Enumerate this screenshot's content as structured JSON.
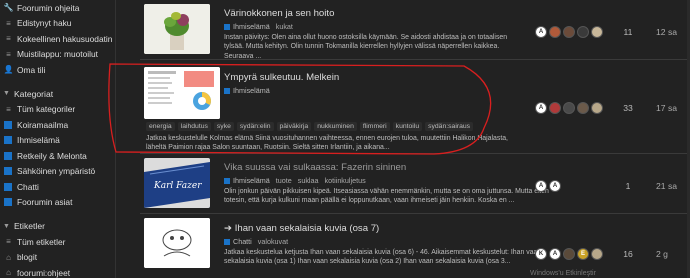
{
  "sidebar": {
    "top_items": [
      {
        "icon": "wrench-icon",
        "label": "Foorumin ohjeita"
      },
      {
        "icon": "list-icon",
        "label": "Edistynyt haku"
      },
      {
        "icon": "list-icon",
        "label": "Kokeellinen hakusuodatin"
      },
      {
        "icon": "list-icon",
        "label": "Muistilappu: muotoilut"
      },
      {
        "icon": "user-icon",
        "label": "Oma tili"
      }
    ],
    "categories_header": "Kategoriat",
    "categories": [
      {
        "label": "Tüm kategoriler",
        "icon": "list-icon",
        "color": ""
      },
      {
        "label": "Koiramaailma",
        "color": "#1a73c8"
      },
      {
        "label": "Ihmiselämä",
        "color": "#1a73c8"
      },
      {
        "label": "Retkeily & Melonta",
        "color": "#1a73c8"
      },
      {
        "label": "Sähköinen ympäristö",
        "color": "#1a73c8"
      },
      {
        "label": "Chatti",
        "color": "#1a73c8"
      },
      {
        "label": "Foorumin asiat",
        "color": "#1a73c8"
      }
    ],
    "tags_header": "Etiketler",
    "tags": [
      {
        "label": "Tüm etiketler",
        "icon": "list-icon"
      },
      {
        "label": "blogit",
        "icon": "tag-icon"
      },
      {
        "label": "foorumi:ohjeet",
        "icon": "tag-icon"
      }
    ]
  },
  "topics": [
    {
      "title": "Värinokkonen ja sen hoito",
      "category": "Ihmiselämä",
      "tag": "kukat",
      "excerpt": "Instan päivitys: Olen aina ollut huono ostoksilla käymään. Se aidosti ahdistaa ja on totaalisen tylsää. Mutta kehityn. Olin tunnin Tokmanilla kierrellen hyllyjen välissä näperrellen kaikkea. Seuraava ...",
      "replies": "11",
      "activity": "12 sa"
    },
    {
      "title": "Ympyrä sulkeutuu. Melkein",
      "category": "Ihmiselämä",
      "tags": [
        "energia",
        "laihdutus",
        "syke",
        "sydän:elin",
        "päiväkirja",
        "nukkuminen",
        "flimmeri",
        "kuntoilu",
        "sydän:sairaus"
      ],
      "excerpt": "Jatkoa keskustelulle Kolmas elämä Siinä vuosituhannen vaihteessa, ennen eurojen tuloa, muutettiin Halikon Hajalasta, läheltä Paimion rajaa Salon suuntaan, Ruotsiin. Sieltä sitten Irlantiin, ja aikana...",
      "replies": "33",
      "activity": "17 sa"
    },
    {
      "title": "Vika suussa vai sulkaassa: Fazerin sininen",
      "category": "Ihmiselämä",
      "tag_list": [
        "tuote",
        "suklaa",
        "kotiinkuljetus"
      ],
      "excerpt": "Olin jonkun päivän pikkuisen kipeä. Itseasiassa vähän enemmänkin, mutta se on oma juttunsa. Mutta eilen totesin, että kurja kulkuni maan päällä ei loppunutkaan, vaan ihmeiseti jäin henkiin. Koska en ...",
      "replies": "1",
      "activity": "21 sa"
    },
    {
      "title": "Ihan vaan sekalaisia kuvia (osa 7)",
      "category": "Chatti",
      "tag": "valokuvat",
      "excerpt": "Jatkaa keskustelua ketjusta Ihan vaan sekalaisia kuvia (osa 6) - 46. Aikaisemmat keskustelut: Ihan vaan sekalaisia kuvia (osa 1) Ihan vaan sekalaisia kuvia (osa 2) Ihan vaan sekalaisia kuvia (osa 3...",
      "replies": "16",
      "activity": "2 g"
    }
  ],
  "footer_hint": "Windows'u Etkinleştir"
}
